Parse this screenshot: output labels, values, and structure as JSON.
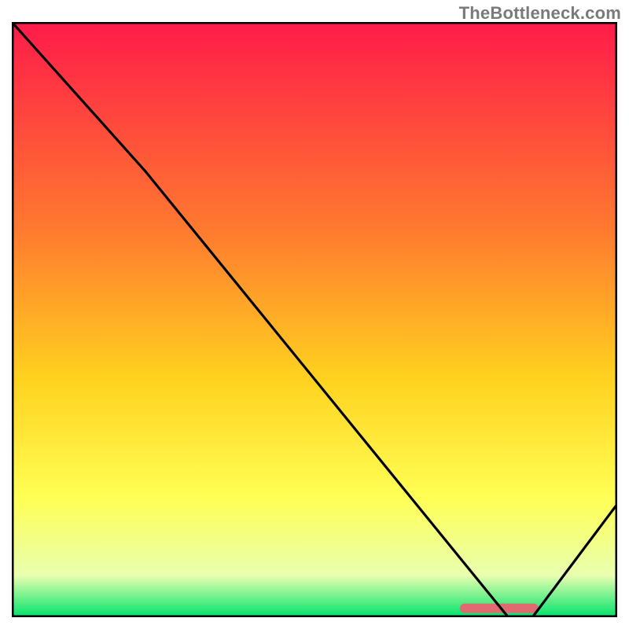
{
  "watermark": "TheBottleneck.com",
  "colors": {
    "gradient_top": "#ff1b4a",
    "gradient_mid1": "#ff7a2f",
    "gradient_mid2": "#ffd21f",
    "gradient_mid3": "#ffff55",
    "gradient_mid4": "#e8ffb0",
    "gradient_bottom": "#00e36b",
    "line": "#000000",
    "bar": "#e06a6f",
    "frame": "#000000"
  },
  "chart_data": {
    "type": "line",
    "title": "",
    "xlabel": "",
    "ylabel": "",
    "xlim": [
      0,
      100
    ],
    "ylim": [
      0,
      100
    ],
    "x": [
      0,
      22,
      82,
      86,
      100
    ],
    "values": [
      100,
      75,
      0,
      0,
      19
    ],
    "annotations": [
      {
        "kind": "highlight-bar",
        "x_start": 74,
        "x_end": 87,
        "y": 1.5
      }
    ]
  }
}
